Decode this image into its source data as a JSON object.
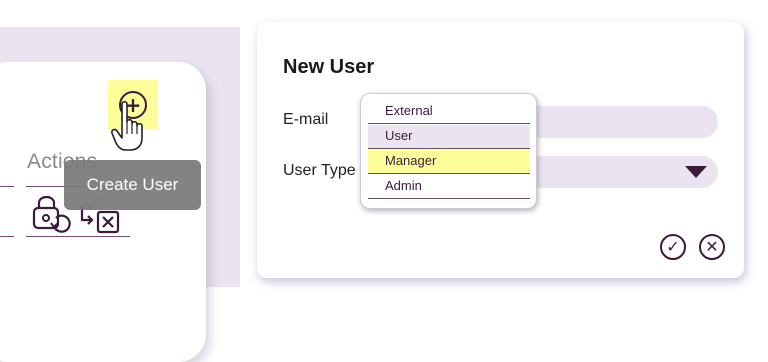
{
  "left_panel": {
    "actions_header": "Actions",
    "tooltip": "Create User",
    "icons": {
      "add": "add-circle-icon",
      "lock": "lock-reset-icon",
      "reassign": "reassign-icon",
      "cursor": "hand-pointer-cursor"
    }
  },
  "dialog": {
    "title": "New User",
    "email_label": "E-mail",
    "user_type_label": "User Type",
    "dropdown_options": [
      "External",
      "User",
      "Manager",
      "Admin"
    ],
    "confirm_icon": "check-circle-icon",
    "cancel_icon": "close-circle-icon"
  },
  "colors": {
    "accent": "#3b1a3b",
    "highlight": "#fdfd9a",
    "field_bg": "#ebe3f0",
    "tooltip_bg": "#787878"
  }
}
